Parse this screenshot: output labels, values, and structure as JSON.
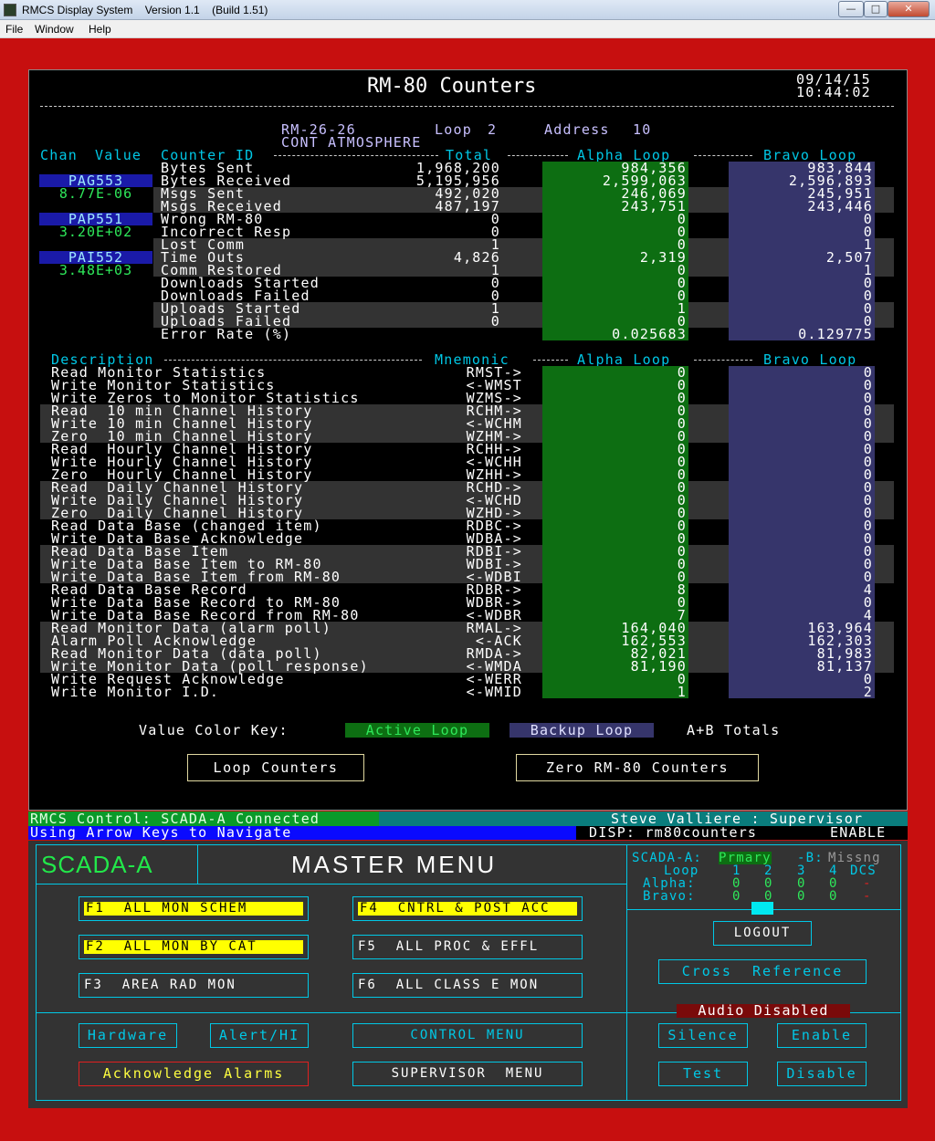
{
  "window": {
    "title": "RMCS Display System    Version 1.1    (Build 1.51)"
  },
  "menubar": [
    "File",
    "Window",
    "Help"
  ],
  "header": {
    "title": "RM-80 Counters",
    "date": "09/14/15",
    "time": "10:44:02"
  },
  "device": {
    "id": "RM-26-26",
    "loop_label": "Loop",
    "loop": "2",
    "address_label": "Address",
    "address": "10",
    "description": "CONT ATMOSPHERE"
  },
  "counters": {
    "headers": {
      "chan": "Chan",
      "value": "Value",
      "counter_id": "Counter ID",
      "total": "Total",
      "alpha": "Alpha Loop",
      "bravo": "Bravo Loop"
    },
    "channels": [
      {
        "name": "PAG553",
        "value": "8.77E-06"
      },
      {
        "name": "PAP551",
        "value": "3.20E+02"
      },
      {
        "name": "PAI552",
        "value": "3.48E+03"
      }
    ],
    "rows": [
      {
        "label": "Bytes Sent",
        "total": "1,968,200",
        "alpha": "984,356",
        "bravo": "983,844"
      },
      {
        "label": "Bytes Received",
        "total": "5,195,956",
        "alpha": "2,599,063",
        "bravo": "2,596,893"
      },
      {
        "label": "Msgs Sent",
        "total": "492,020",
        "alpha": "246,069",
        "bravo": "245,951"
      },
      {
        "label": "Msgs Received",
        "total": "487,197",
        "alpha": "243,751",
        "bravo": "243,446"
      },
      {
        "label": "Wrong RM-80",
        "total": "0",
        "alpha": "0",
        "bravo": "0"
      },
      {
        "label": "Incorrect Resp",
        "total": "0",
        "alpha": "0",
        "bravo": "0"
      },
      {
        "label": "Lost Comm",
        "total": "1",
        "alpha": "0",
        "bravo": "1"
      },
      {
        "label": "Time Outs",
        "total": "4,826",
        "alpha": "2,319",
        "bravo": "2,507"
      },
      {
        "label": "Comm Restored",
        "total": "1",
        "alpha": "0",
        "bravo": "1"
      },
      {
        "label": "Downloads Started",
        "total": "0",
        "alpha": "0",
        "bravo": "0"
      },
      {
        "label": "Downloads Failed",
        "total": "0",
        "alpha": "0",
        "bravo": "0"
      },
      {
        "label": "Uploads Started",
        "total": "1",
        "alpha": "1",
        "bravo": "0"
      },
      {
        "label": "Uploads Failed",
        "total": "0",
        "alpha": "0",
        "bravo": "0"
      },
      {
        "label": "Error Rate (%)",
        "total": "",
        "alpha": "0.025683",
        "bravo": "0.129775"
      }
    ]
  },
  "commands": {
    "headers": {
      "description": "Description",
      "mnemonic": "Mnemonic",
      "alpha": "Alpha Loop",
      "bravo": "Bravo Loop"
    },
    "rows": [
      {
        "desc": "Read Monitor Statistics",
        "mn": "RMST->",
        "alpha": "0",
        "bravo": "0"
      },
      {
        "desc": "Write Monitor Statistics",
        "mn": "<-WMST",
        "alpha": "0",
        "bravo": "0"
      },
      {
        "desc": "Write Zeros to Monitor Statistics",
        "mn": "WZMS->",
        "alpha": "0",
        "bravo": "0"
      },
      {
        "desc": "Read  10 min Channel History",
        "mn": "RCHM->",
        "alpha": "0",
        "bravo": "0"
      },
      {
        "desc": "Write 10 min Channel History",
        "mn": "<-WCHM",
        "alpha": "0",
        "bravo": "0"
      },
      {
        "desc": "Zero  10 min Channel History",
        "mn": "WZHM->",
        "alpha": "0",
        "bravo": "0"
      },
      {
        "desc": "Read  Hourly Channel History",
        "mn": "RCHH->",
        "alpha": "0",
        "bravo": "0"
      },
      {
        "desc": "Write Hourly Channel History",
        "mn": "<-WCHH",
        "alpha": "0",
        "bravo": "0"
      },
      {
        "desc": "Zero  Hourly Channel History",
        "mn": "WZHH->",
        "alpha": "0",
        "bravo": "0"
      },
      {
        "desc": "Read  Daily Channel History",
        "mn": "RCHD->",
        "alpha": "0",
        "bravo": "0"
      },
      {
        "desc": "Write Daily Channel History",
        "mn": "<-WCHD",
        "alpha": "0",
        "bravo": "0"
      },
      {
        "desc": "Zero  Daily Channel History",
        "mn": "WZHD->",
        "alpha": "0",
        "bravo": "0"
      },
      {
        "desc": "Read Data Base (changed item)",
        "mn": "RDBC->",
        "alpha": "0",
        "bravo": "0"
      },
      {
        "desc": "Write Data Base Acknowledge",
        "mn": "WDBA->",
        "alpha": "0",
        "bravo": "0"
      },
      {
        "desc": "Read Data Base Item",
        "mn": "RDBI->",
        "alpha": "0",
        "bravo": "0"
      },
      {
        "desc": "Write Data Base Item to RM-80",
        "mn": "WDBI->",
        "alpha": "0",
        "bravo": "0"
      },
      {
        "desc": "Write Data Base Item from RM-80",
        "mn": "<-WDBI",
        "alpha": "0",
        "bravo": "0"
      },
      {
        "desc": "Read Data Base Record",
        "mn": "RDBR->",
        "alpha": "8",
        "bravo": "4"
      },
      {
        "desc": "Write Data Base Record to RM-80",
        "mn": "WDBR->",
        "alpha": "0",
        "bravo": "0"
      },
      {
        "desc": "Write Data Base Record from RM-80",
        "mn": "<-WDBR",
        "alpha": "7",
        "bravo": "4"
      },
      {
        "desc": "Read Monitor Data (alarm poll)",
        "mn": "RMAL->",
        "alpha": "164,040",
        "bravo": "163,964"
      },
      {
        "desc": "Alarm Poll Acknowledge",
        "mn": "<-ACK",
        "alpha": "162,553",
        "bravo": "162,303"
      },
      {
        "desc": "Read Monitor Data (data poll)",
        "mn": "RMDA->",
        "alpha": "82,021",
        "bravo": "81,983"
      },
      {
        "desc": "Write Monitor Data (poll response)",
        "mn": "<-WMDA",
        "alpha": "81,190",
        "bravo": "81,137"
      },
      {
        "desc": "Write Request Acknowledge",
        "mn": "<-WERR",
        "alpha": "0",
        "bravo": "0"
      },
      {
        "desc": "Write Monitor I.D.",
        "mn": "<-WMID",
        "alpha": "1",
        "bravo": "2"
      }
    ]
  },
  "key": {
    "label": "Value Color Key:",
    "active": "Active Loop",
    "backup": "Backup Loop",
    "totals": "A+B Totals"
  },
  "buttons": {
    "loop_counters": "Loop Counters",
    "zero_counters": "Zero RM-80 Counters"
  },
  "status": {
    "control": "RMCS Control: SCADA-A Connected",
    "user": "Steve Valliere : Supervisor",
    "nav": "Using Arrow Keys to Navigate",
    "disp": "DISP: rm80counters",
    "mode": "ENABLE"
  },
  "menu": {
    "scada": "SCADA-A",
    "title": "MASTER MENU",
    "state_a_label": "SCADA-A:",
    "state_a": "Prmary",
    "state_b_label": "-B:",
    "state_b": "Missng",
    "loop_label": "Loop",
    "loops": [
      "1",
      "2",
      "3",
      "4",
      "DCS"
    ],
    "alpha_label": "Alpha:",
    "alpha_vals": [
      "0",
      "0",
      "0",
      "0",
      "-"
    ],
    "bravo_label": "Bravo:",
    "bravo_vals": [
      "0",
      "0",
      "0",
      "0",
      "-"
    ],
    "f1": "F1  ALL MON SCHEM",
    "f2": "F2  ALL MON BY CAT",
    "f3": "F3  AREA RAD MON",
    "f4": "F4  CNTRL & POST ACC",
    "f5": "F5  ALL PROC & EFFL",
    "f6": "F6  ALL CLASS E MON",
    "logout": "LOGOUT",
    "cross_ref": "Cross  Reference",
    "hardware": "Hardware",
    "alert": "Alert/HI",
    "control_menu": "CONTROL MENU",
    "ack_alarms": "Acknowledge Alarms",
    "supervisor_menu": "SUPERVISOR  MENU",
    "audio": "Audio Disabled",
    "silence": "Silence",
    "enable": "Enable",
    "test": "Test",
    "disable": "Disable"
  }
}
